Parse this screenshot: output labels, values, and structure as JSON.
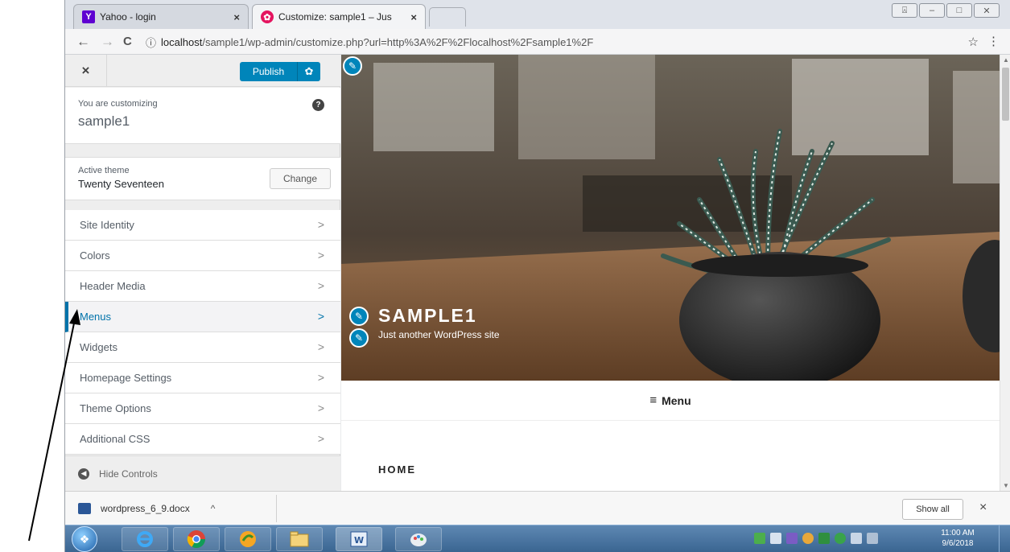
{
  "browser": {
    "tabs": [
      {
        "title": "Yahoo - login",
        "close": "×",
        "favicon_color": "#5f01d1",
        "favicon": "Y"
      },
      {
        "title": "Customize: sample1 – Jus",
        "close": "×",
        "favicon_color": "#e4145f",
        "favicon": "✿"
      }
    ],
    "nav": {
      "back": "←",
      "forward": "→",
      "reload": "C"
    },
    "url_prefix": "ⓘ",
    "url_host": "localhost",
    "url_path": "/sample1/wp-admin/customize.php?url=http%3A%2F%2Flocalhost%2Fsample1%2F",
    "star": "☆",
    "menu": "⋮"
  },
  "customizer": {
    "close": "×",
    "publish_label": "Publish",
    "publish_gear": "✿",
    "customizing_label": "You are customizing",
    "site_name": "sample1",
    "help": "?",
    "active_theme_label": "Active theme",
    "theme_name": "Twenty Seventeen",
    "change_label": "Change",
    "sections": [
      {
        "label": "Site Identity",
        "chevron": ">"
      },
      {
        "label": "Colors",
        "chevron": ">"
      },
      {
        "label": "Header Media",
        "chevron": ">"
      },
      {
        "label": "Menus",
        "chevron": ">"
      },
      {
        "label": "Widgets",
        "chevron": ">"
      },
      {
        "label": "Homepage Settings",
        "chevron": ">"
      },
      {
        "label": "Theme Options",
        "chevron": ">"
      },
      {
        "label": "Additional CSS",
        "chevron": ">"
      }
    ],
    "hide_controls": "Hide Controls",
    "accent": "#0085ba"
  },
  "preview": {
    "pencil": "✎",
    "site_title": "SAMPLE1",
    "tagline": "Just another WordPress site",
    "menu_icon": "≡",
    "menu_label": "Menu",
    "home_label": "HOME"
  },
  "download_shelf": {
    "filename": "wordpress_6_9.docx",
    "caret": "^",
    "show_all": "Show all",
    "close": "×"
  },
  "taskbar": {
    "time": "11:00 AM",
    "date": "9/6/2018"
  }
}
